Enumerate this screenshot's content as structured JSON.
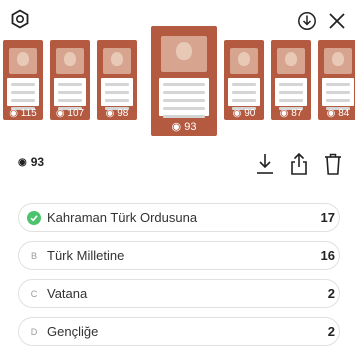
{
  "toolbar": {
    "left_icon": "hexagon-settings-icon",
    "right_icons": [
      "download-circle-icon",
      "close-icon"
    ]
  },
  "thumbnails": [
    {
      "views": "115",
      "selected": false
    },
    {
      "views": "107",
      "selected": false
    },
    {
      "views": "98",
      "selected": false
    },
    {
      "views": "93",
      "selected": true
    },
    {
      "views": "90",
      "selected": false
    },
    {
      "views": "87",
      "selected": false
    },
    {
      "views": "84",
      "selected": false
    }
  ],
  "stats": {
    "views": "93",
    "actions": [
      "download-icon",
      "share-icon",
      "trash-icon"
    ]
  },
  "answers": [
    {
      "letter": "",
      "text": "Kahraman Türk Ordusuna",
      "count": "17",
      "correct": true
    },
    {
      "letter": "B",
      "text": "Türk Milletine",
      "count": "16",
      "correct": false
    },
    {
      "letter": "C",
      "text": "Vatana",
      "count": "2",
      "correct": false
    },
    {
      "letter": "D",
      "text": "Gençliğe",
      "count": "2",
      "correct": false
    }
  ],
  "colors": {
    "accent_correct": "#4cc36d",
    "thumbnail_bg": "#b45a41"
  }
}
